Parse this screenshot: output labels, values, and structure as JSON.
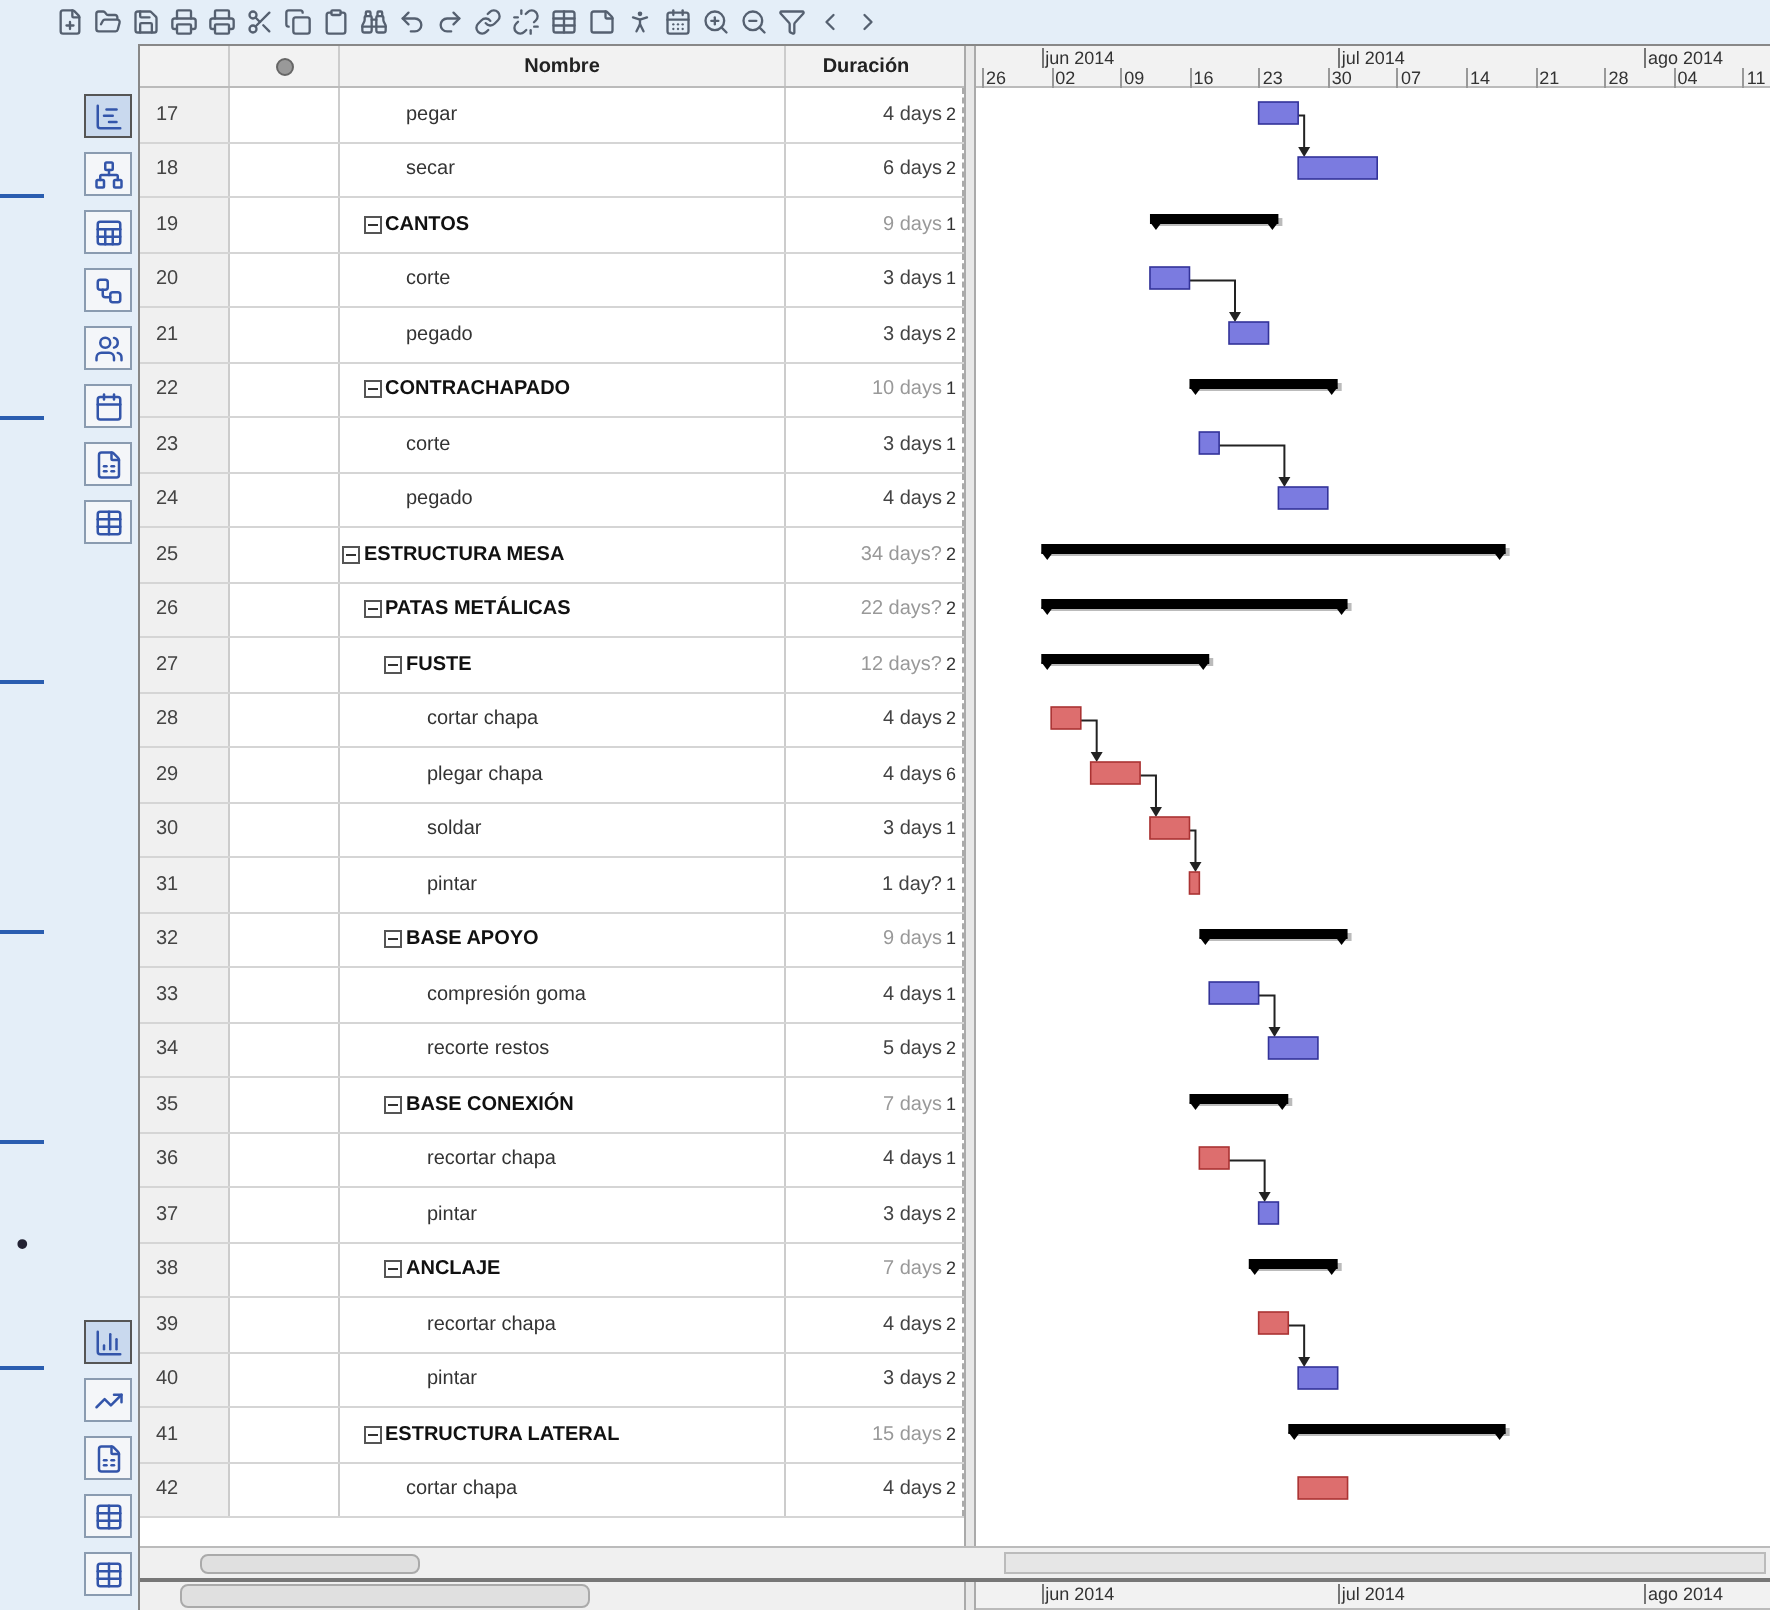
{
  "table": {
    "columns": [
      {
        "label": "Nombre",
        "kind": "name"
      },
      {
        "label": "Duración",
        "kind": "duration"
      }
    ]
  },
  "tasks": [
    {
      "kind": "continued",
      "children": [
        {
          "kind": "continued",
          "children": [
            {
              "kind": "task",
              "id": "17",
              "name": "pegar",
              "duration": "4 days",
              "column_5": "2",
              "critical": false
            },
            {
              "kind": "task",
              "id": "18",
              "name": "secar",
              "duration": "6 days",
              "column_5": "2",
              "critical": false
            }
          ]
        },
        {
          "kind": "summary",
          "id": "19",
          "name": "CANTOS",
          "duration": "9 days",
          "column_5": "1",
          "expanded": true,
          "children": [
            {
              "kind": "task",
              "id": "20",
              "name": "corte",
              "duration": "3 days",
              "column_5": "1",
              "critical": false
            },
            {
              "kind": "task",
              "id": "21",
              "name": "pegado",
              "duration": "3 days",
              "column_5": "2",
              "critical": false
            }
          ]
        },
        {
          "kind": "summary",
          "id": "22",
          "name": "CONTRACHAPADO",
          "duration": "10 days",
          "column_5": "1",
          "expanded": true,
          "children": [
            {
              "kind": "task",
              "id": "23",
              "name": "corte",
              "duration": "3 days",
              "column_5": "1",
              "critical": false
            },
            {
              "kind": "task",
              "id": "24",
              "name": "pegado",
              "duration": "4 days",
              "column_5": "2",
              "critical": false
            }
          ]
        }
      ]
    },
    {
      "kind": "summary",
      "id": "25",
      "name": "ESTRUCTURA MESA",
      "duration": "34 days?",
      "column_5": "2",
      "expanded": true,
      "children": [
        {
          "kind": "summary",
          "id": "26",
          "name": "PATAS METÁLICAS",
          "duration": "22 days?",
          "column_5": "2",
          "expanded": true,
          "children": [
            {
              "kind": "summary",
              "id": "27",
              "name": "FUSTE",
              "duration": "12 days?",
              "column_5": "2",
              "expanded": true,
              "children": [
                {
                  "kind": "task",
                  "id": "28",
                  "name": "cortar chapa",
                  "duration": "4 days",
                  "column_5": "2",
                  "critical": true
                },
                {
                  "kind": "task",
                  "id": "29",
                  "name": "plegar chapa",
                  "duration": "4 days",
                  "column_5": "6",
                  "critical": true
                },
                {
                  "kind": "task",
                  "id": "30",
                  "name": "soldar",
                  "duration": "3 days",
                  "column_5": "1",
                  "critical": true
                },
                {
                  "kind": "task",
                  "id": "31",
                  "name": "pintar",
                  "duration": "1 day?",
                  "column_5": "1",
                  "critical": true
                }
              ]
            },
            {
              "kind": "summary",
              "id": "32",
              "name": "BASE APOYO",
              "duration": "9 days",
              "column_5": "1",
              "expanded": true,
              "children": [
                {
                  "kind": "task",
                  "id": "33",
                  "name": "compresión goma",
                  "duration": "4 days",
                  "column_5": "1",
                  "critical": false
                },
                {
                  "kind": "task",
                  "id": "34",
                  "name": "recorte restos",
                  "duration": "5 days",
                  "column_5": "2",
                  "critical": false
                }
              ]
            },
            {
              "kind": "summary",
              "id": "35",
              "name": "BASE CONEXIÓN",
              "duration": "7 days",
              "column_5": "1",
              "expanded": true,
              "children": [
                {
                  "kind": "task",
                  "id": "36",
                  "name": "recortar chapa",
                  "duration": "4 days",
                  "column_5": "1",
                  "critical": true
                },
                {
                  "kind": "task",
                  "id": "37",
                  "name": "pintar",
                  "duration": "3 days",
                  "column_5": "2",
                  "critical": false
                }
              ]
            },
            {
              "kind": "summary",
              "id": "38",
              "name": "ANCLAJE",
              "duration": "7 days",
              "column_5": "2",
              "expanded": true,
              "children": [
                {
                  "kind": "task",
                  "id": "39",
                  "name": "recortar chapa",
                  "duration": "4 days",
                  "column_5": "2",
                  "critical": true
                },
                {
                  "kind": "task",
                  "id": "40",
                  "name": "pintar",
                  "duration": "3 days",
                  "column_5": "2",
                  "critical": false
                }
              ]
            }
          ]
        },
        {
          "kind": "summary",
          "id": "41",
          "name": "ESTRUCTURA LATERAL",
          "duration": "15 days",
          "column_5": "2",
          "expanded": true,
          "children": [
            {
              "kind": "task",
              "id": "42",
              "name": "cortar chapa",
              "duration": "4 days",
              "column_5": "2",
              "critical": true
            }
          ]
        }
      ]
    }
  ],
  "timeline": {
    "months": [
      {
        "label": "jun 2014"
      },
      {
        "label": "jul 2014"
      },
      {
        "label": "ago 2014"
      }
    ],
    "weeks": [
      "26",
      "02",
      "09",
      "16",
      "23",
      "30",
      "07",
      "14",
      "21",
      "28",
      "04",
      "11"
    ]
  },
  "bottom_timeline": {
    "months": [
      {
        "label": "jun 2014"
      },
      {
        "label": "jul 2014"
      },
      {
        "label": "ago 2014"
      }
    ]
  },
  "views_top": [
    {
      "kind": "gantt",
      "selected": true
    },
    {
      "kind": "network",
      "selected": false
    },
    {
      "kind": "resources",
      "selected": false
    },
    {
      "kind": "wbs",
      "selected": false
    },
    {
      "kind": "rbs",
      "selected": false
    },
    {
      "kind": "calendar",
      "selected": false
    },
    {
      "kind": "report",
      "selected": false
    },
    {
      "kind": "resource-usage",
      "selected": false
    }
  ],
  "views_bottom": [
    {
      "kind": "histogram",
      "selected": true
    },
    {
      "kind": "charts",
      "selected": false
    },
    {
      "kind": "report",
      "selected": false
    },
    {
      "kind": "resource-usage",
      "selected": false
    },
    {
      "kind": "resource-usage",
      "selected": false
    }
  ],
  "bullet": "•"
}
